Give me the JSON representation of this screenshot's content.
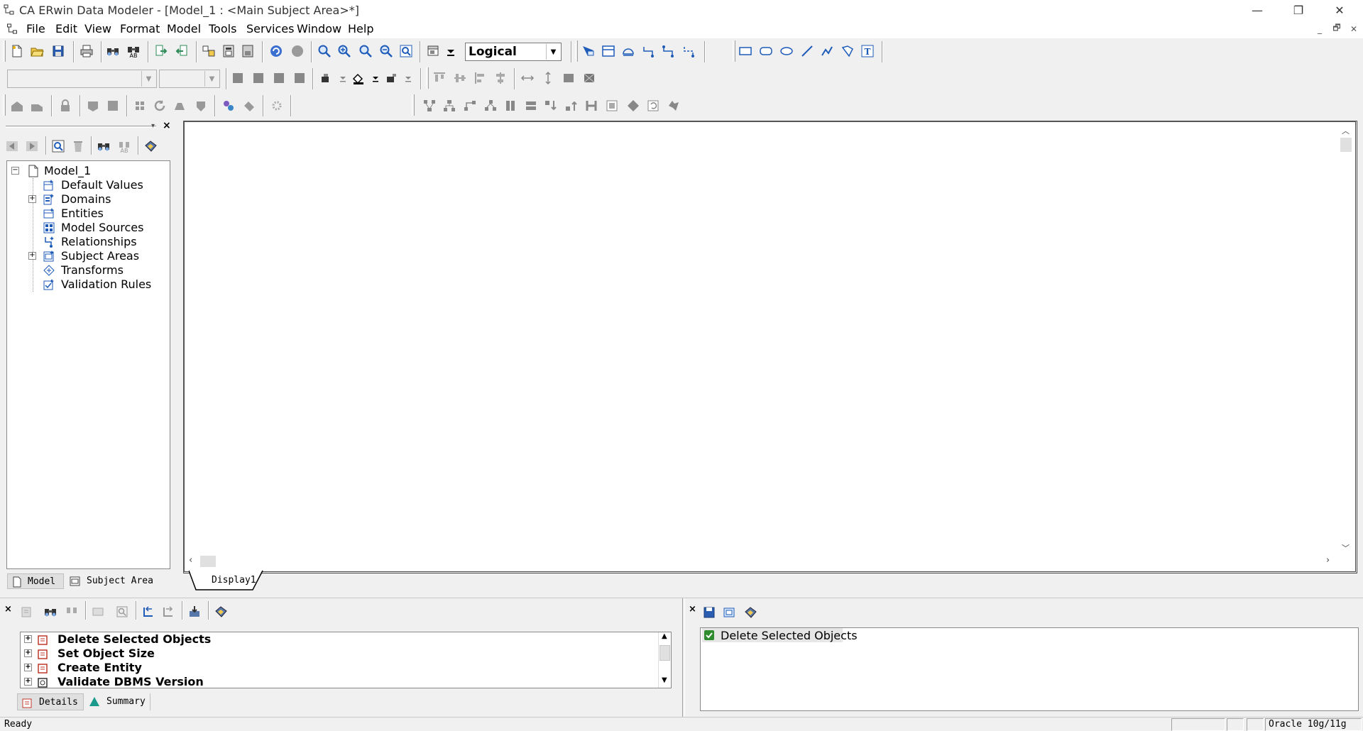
{
  "window": {
    "title": "CA ERwin Data Modeler - [Model_1 : <Main Subject Area>*]",
    "minimize_label": "—",
    "restore_label": "❐",
    "close_label": "✕"
  },
  "menu": {
    "items": [
      {
        "label": "File"
      },
      {
        "label": "Edit"
      },
      {
        "label": "View"
      },
      {
        "label": "Format"
      },
      {
        "label": "Model"
      },
      {
        "label": "Tools"
      },
      {
        "label": "Services"
      },
      {
        "label": "Window"
      },
      {
        "label": "Help"
      }
    ],
    "mdi_minimize": "_",
    "mdi_restore": "🗗",
    "mdi_close": "✕"
  },
  "toolbar": {
    "view_mode": "Logical",
    "font_combo": "",
    "size_combo": ""
  },
  "tree": {
    "root": "Model_1",
    "items": [
      {
        "label": "Default Values",
        "expandable": false
      },
      {
        "label": "Domains",
        "expandable": true
      },
      {
        "label": "Entities",
        "expandable": false
      },
      {
        "label": "Model Sources",
        "expandable": false
      },
      {
        "label": "Relationships",
        "expandable": false
      },
      {
        "label": "Subject Areas",
        "expandable": true
      },
      {
        "label": "Transforms",
        "expandable": false
      },
      {
        "label": "Validation Rules",
        "expandable": false
      }
    ],
    "tabs": [
      {
        "label": "Model"
      },
      {
        "label": "Subject Area"
      }
    ]
  },
  "canvas": {
    "tab": "Display1"
  },
  "action_log": {
    "items": [
      {
        "label": "Delete Selected Objects"
      },
      {
        "label": "Set Object Size"
      },
      {
        "label": "Create Entity"
      },
      {
        "label": "Validate DBMS Version"
      }
    ],
    "tabs": [
      {
        "label": "Details"
      },
      {
        "label": "Summary"
      }
    ]
  },
  "detail_pane": {
    "items": [
      {
        "label": "Delete Selected Objects"
      }
    ]
  },
  "status": {
    "message": "Ready",
    "target_db": "Oracle 10g/11g"
  },
  "colors": {
    "accent_blue": "#1e5bb8",
    "icon_red": "#c0392b",
    "icon_green": "#2e8b2e"
  }
}
